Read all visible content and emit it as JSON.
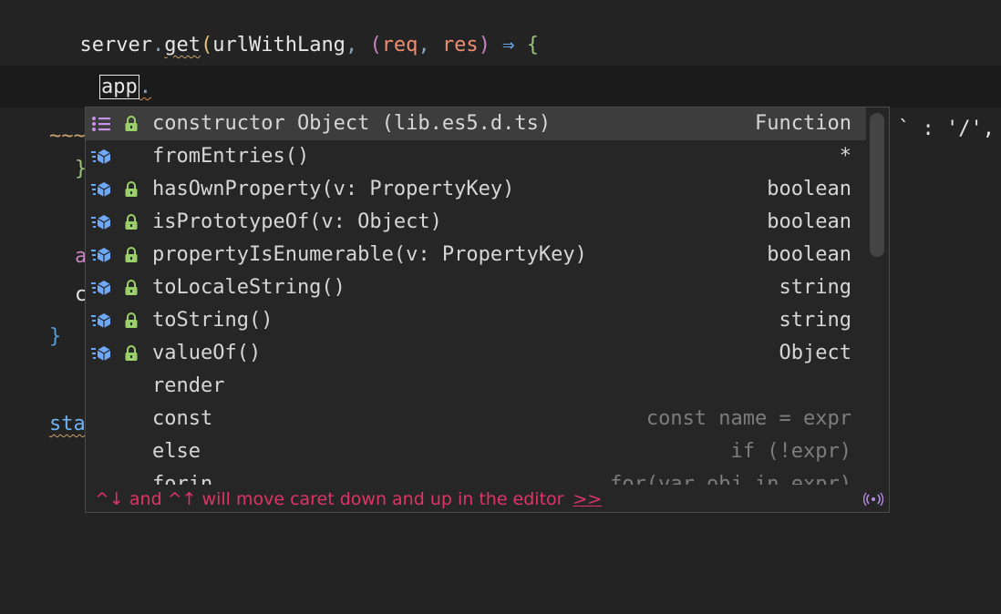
{
  "editor": {
    "line1": {
      "indent": "  ",
      "obj": "server",
      "dot": ".",
      "method": "get",
      "paren_open": "(",
      "arg": "urlWithLang",
      "comma": ", ",
      "lparen2": "(",
      "p1": "req",
      "sep": ", ",
      "p2": "res",
      "rparen2": ")",
      "arrow": " ⇒ ",
      "brace": "{"
    },
    "line2": {
      "indent": "    ",
      "typed": "app",
      "dot": "."
    },
    "bg_fragments": {
      "a": "~~~~",
      "b": "}",
      "c": "a",
      "d": "c",
      "e": "}",
      "f": "sta",
      "g": "` : '/',"
    }
  },
  "completion": {
    "items": [
      {
        "icon": "list-icon",
        "lock": true,
        "label": "constructor Object (lib.es5.d.ts)",
        "type": "Function",
        "dim": false,
        "selected": true
      },
      {
        "icon": "method-cube-icon",
        "lock": false,
        "label": "fromEntries()",
        "type": "*",
        "dim": false
      },
      {
        "icon": "method-cube-icon",
        "lock": true,
        "label": "hasOwnProperty(v: PropertyKey)",
        "type": "boolean",
        "dim": false
      },
      {
        "icon": "method-cube-icon",
        "lock": true,
        "label": "isPrototypeOf(v: Object)",
        "type": "boolean",
        "dim": false
      },
      {
        "icon": "method-cube-icon",
        "lock": true,
        "label": "propertyIsEnumerable(v: PropertyKey)",
        "type": "boolean",
        "dim": false
      },
      {
        "icon": "method-cube-icon",
        "lock": true,
        "label": "toLocaleString()",
        "type": "string",
        "dim": false
      },
      {
        "icon": "method-cube-icon",
        "lock": true,
        "label": "toString()",
        "type": "string",
        "dim": false
      },
      {
        "icon": "method-cube-icon",
        "lock": true,
        "label": "valueOf()",
        "type": "Object",
        "dim": false
      },
      {
        "icon": "",
        "lock": false,
        "label": "render",
        "type": "",
        "dim": false
      },
      {
        "icon": "",
        "lock": false,
        "label": "const",
        "type": "const name = expr",
        "dim": true
      },
      {
        "icon": "",
        "lock": false,
        "label": "else",
        "type": "if (!expr)",
        "dim": true
      },
      {
        "icon": "",
        "lock": false,
        "label": "forin",
        "type": "for(var obj in expr)",
        "dim": true
      }
    ],
    "hint_text": "^↓ and ^↑ will move caret down and up in the editor",
    "hint_link": ">>"
  },
  "colors": {
    "accent_hint": "#e0336b",
    "method_icon": "#6fa8f7",
    "lock": "#9bd068",
    "list_icon": "#c792ea"
  }
}
